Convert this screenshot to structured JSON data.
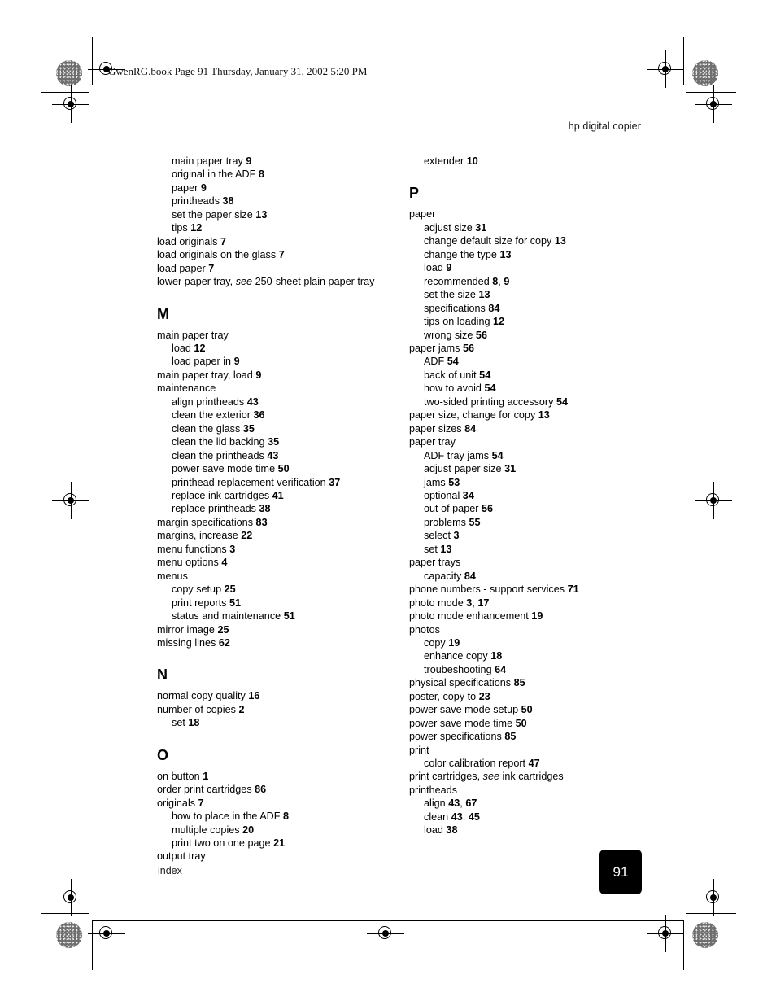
{
  "print_header": {
    "text": "GwenRG.book  Page 91  Thursday, January 31, 2002  5:20 PM"
  },
  "running_header": {
    "text": "hp digital  copier"
  },
  "footer": {
    "section_label": "index",
    "page_number": "91"
  },
  "colors": {
    "text": "#000000",
    "page_badge_bg": "#000000",
    "page_badge_text": "#ffffff",
    "paper": "#ffffff"
  },
  "index": {
    "left_column": [
      {
        "type": "entry",
        "level": 2,
        "text": "main paper tray ",
        "pages": "9"
      },
      {
        "type": "entry",
        "level": 2,
        "text": "original in the ADF ",
        "pages": "8"
      },
      {
        "type": "entry",
        "level": 2,
        "text": "paper ",
        "pages": "9"
      },
      {
        "type": "entry",
        "level": 2,
        "text": "printheads ",
        "pages": "38"
      },
      {
        "type": "entry",
        "level": 2,
        "text": "set the paper size ",
        "pages": "13"
      },
      {
        "type": "entry",
        "level": 2,
        "text": "tips ",
        "pages": "12"
      },
      {
        "type": "entry",
        "level": 1,
        "text": "load originals ",
        "pages": "7"
      },
      {
        "type": "entry",
        "level": 1,
        "text": "load originals on the glass ",
        "pages": "7"
      },
      {
        "type": "entry",
        "level": 1,
        "text": "load paper ",
        "pages": "7"
      },
      {
        "type": "entry",
        "level": 1,
        "text": "lower paper tray, ",
        "italic": "see",
        "after": " 250-sheet plain paper tray",
        "pages": ""
      },
      {
        "type": "letter",
        "text": "M"
      },
      {
        "type": "entry",
        "level": 1,
        "text": "main paper tray",
        "pages": ""
      },
      {
        "type": "entry",
        "level": 2,
        "text": "load ",
        "pages": "12"
      },
      {
        "type": "entry",
        "level": 2,
        "text": "load paper in ",
        "pages": "9"
      },
      {
        "type": "entry",
        "level": 1,
        "text": "main paper tray, load ",
        "pages": "9"
      },
      {
        "type": "entry",
        "level": 1,
        "text": "maintenance",
        "pages": ""
      },
      {
        "type": "entry",
        "level": 2,
        "text": "align printheads ",
        "pages": "43"
      },
      {
        "type": "entry",
        "level": 2,
        "text": "clean the exterior ",
        "pages": "36"
      },
      {
        "type": "entry",
        "level": 2,
        "text": "clean the glass ",
        "pages": "35"
      },
      {
        "type": "entry",
        "level": 2,
        "text": "clean the lid backing ",
        "pages": "35"
      },
      {
        "type": "entry",
        "level": 2,
        "text": "clean the printheads ",
        "pages": "43"
      },
      {
        "type": "entry",
        "level": 2,
        "text": "power save mode time ",
        "pages": "50"
      },
      {
        "type": "entry",
        "level": 2,
        "text": "printhead replacement verification ",
        "pages": "37"
      },
      {
        "type": "entry",
        "level": 2,
        "text": "replace ink cartridges ",
        "pages": "41"
      },
      {
        "type": "entry",
        "level": 2,
        "text": "replace printheads ",
        "pages": "38"
      },
      {
        "type": "entry",
        "level": 1,
        "text": "margin specifications ",
        "pages": "83"
      },
      {
        "type": "entry",
        "level": 1,
        "text": "margins, increase ",
        "pages": "22"
      },
      {
        "type": "entry",
        "level": 1,
        "text": "menu functions ",
        "pages": "3"
      },
      {
        "type": "entry",
        "level": 1,
        "text": "menu options ",
        "pages": "4"
      },
      {
        "type": "entry",
        "level": 1,
        "text": "menus",
        "pages": ""
      },
      {
        "type": "entry",
        "level": 2,
        "text": "copy setup ",
        "pages": "25"
      },
      {
        "type": "entry",
        "level": 2,
        "text": "print reports ",
        "pages": "51"
      },
      {
        "type": "entry",
        "level": 2,
        "text": "status and maintenance ",
        "pages": "51"
      },
      {
        "type": "entry",
        "level": 1,
        "text": "mirror image ",
        "pages": "25"
      },
      {
        "type": "entry",
        "level": 1,
        "text": "missing lines ",
        "pages": "62"
      },
      {
        "type": "letter",
        "text": "N"
      },
      {
        "type": "entry",
        "level": 1,
        "text": "normal copy quality ",
        "pages": "16"
      },
      {
        "type": "entry",
        "level": 1,
        "text": "number of copies ",
        "pages": "2"
      },
      {
        "type": "entry",
        "level": 2,
        "text": "set ",
        "pages": "18"
      },
      {
        "type": "letter",
        "text": "O"
      },
      {
        "type": "entry",
        "level": 1,
        "text": "on button ",
        "pages": "1"
      },
      {
        "type": "entry",
        "level": 1,
        "text": "order print cartridges ",
        "pages": "86"
      },
      {
        "type": "entry",
        "level": 1,
        "text": "originals ",
        "pages": "7"
      },
      {
        "type": "entry",
        "level": 2,
        "text": "how to place in the ADF ",
        "pages": "8"
      },
      {
        "type": "entry",
        "level": 2,
        "text": "multiple copies ",
        "pages": "20"
      },
      {
        "type": "entry",
        "level": 2,
        "text": "print two on one page ",
        "pages": "21"
      },
      {
        "type": "entry",
        "level": 1,
        "text": "output tray",
        "pages": ""
      }
    ],
    "right_column": [
      {
        "type": "entry",
        "level": 2,
        "text": "extender ",
        "pages": "10"
      },
      {
        "type": "letter",
        "text": "P"
      },
      {
        "type": "entry",
        "level": 1,
        "text": "paper",
        "pages": ""
      },
      {
        "type": "entry",
        "level": 2,
        "text": "adjust size ",
        "pages": "31"
      },
      {
        "type": "entry",
        "level": 2,
        "text": "change default size for copy ",
        "pages": "13"
      },
      {
        "type": "entry",
        "level": 2,
        "text": "change the type ",
        "pages": "13"
      },
      {
        "type": "entry",
        "level": 2,
        "text": "load ",
        "pages": "9"
      },
      {
        "type": "entry",
        "level": 2,
        "text": "recommended ",
        "pages": "8",
        "pages2": "9"
      },
      {
        "type": "entry",
        "level": 2,
        "text": "set the size ",
        "pages": "13"
      },
      {
        "type": "entry",
        "level": 2,
        "text": "specifications ",
        "pages": "84"
      },
      {
        "type": "entry",
        "level": 2,
        "text": "tips on loading ",
        "pages": "12"
      },
      {
        "type": "entry",
        "level": 2,
        "text": "wrong size ",
        "pages": "56"
      },
      {
        "type": "entry",
        "level": 1,
        "text": "paper jams ",
        "pages": "56"
      },
      {
        "type": "entry",
        "level": 2,
        "text": "ADF ",
        "pages": "54"
      },
      {
        "type": "entry",
        "level": 2,
        "text": "back of unit ",
        "pages": "54"
      },
      {
        "type": "entry",
        "level": 2,
        "text": "how to avoid ",
        "pages": "54"
      },
      {
        "type": "entry",
        "level": 2,
        "text": "two-sided printing accessory ",
        "pages": "54"
      },
      {
        "type": "entry",
        "level": 1,
        "text": "paper size, change for copy ",
        "pages": "13"
      },
      {
        "type": "entry",
        "level": 1,
        "text": "paper sizes ",
        "pages": "84"
      },
      {
        "type": "entry",
        "level": 1,
        "text": "paper tray",
        "pages": ""
      },
      {
        "type": "entry",
        "level": 2,
        "text": "ADF tray jams ",
        "pages": "54"
      },
      {
        "type": "entry",
        "level": 2,
        "text": "adjust paper size ",
        "pages": "31"
      },
      {
        "type": "entry",
        "level": 2,
        "text": "jams ",
        "pages": "53"
      },
      {
        "type": "entry",
        "level": 2,
        "text": "optional ",
        "pages": "34"
      },
      {
        "type": "entry",
        "level": 2,
        "text": "out of paper ",
        "pages": "56"
      },
      {
        "type": "entry",
        "level": 2,
        "text": "problems ",
        "pages": "55"
      },
      {
        "type": "entry",
        "level": 2,
        "text": "select ",
        "pages": "3"
      },
      {
        "type": "entry",
        "level": 2,
        "text": "set ",
        "pages": "13"
      },
      {
        "type": "entry",
        "level": 1,
        "text": "paper trays",
        "pages": ""
      },
      {
        "type": "entry",
        "level": 2,
        "text": "capacity ",
        "pages": "84"
      },
      {
        "type": "entry",
        "level": 1,
        "text": "phone numbers - support services ",
        "pages": "71"
      },
      {
        "type": "entry",
        "level": 1,
        "text": "photo mode ",
        "pages": "3",
        "pages2": "17"
      },
      {
        "type": "entry",
        "level": 1,
        "text": "photo mode enhancement ",
        "pages": "19"
      },
      {
        "type": "entry",
        "level": 1,
        "text": "photos",
        "pages": ""
      },
      {
        "type": "entry",
        "level": 2,
        "text": "copy ",
        "pages": "19"
      },
      {
        "type": "entry",
        "level": 2,
        "text": "enhance copy ",
        "pages": "18"
      },
      {
        "type": "entry",
        "level": 2,
        "text": "troubeshooting ",
        "pages": "64"
      },
      {
        "type": "entry",
        "level": 1,
        "text": "physical specifications ",
        "pages": "85"
      },
      {
        "type": "entry",
        "level": 1,
        "text": "poster, copy to ",
        "pages": "23"
      },
      {
        "type": "entry",
        "level": 1,
        "text": "power save mode setup ",
        "pages": "50"
      },
      {
        "type": "entry",
        "level": 1,
        "text": "power save mode time ",
        "pages": "50"
      },
      {
        "type": "entry",
        "level": 1,
        "text": "power specifications ",
        "pages": "85"
      },
      {
        "type": "entry",
        "level": 1,
        "text": "print",
        "pages": ""
      },
      {
        "type": "entry",
        "level": 2,
        "text": "color calibration report ",
        "pages": "47"
      },
      {
        "type": "entry",
        "level": 1,
        "text": "print cartridges, ",
        "italic": "see",
        "after": " ink cartridges",
        "pages": ""
      },
      {
        "type": "entry",
        "level": 1,
        "text": "printheads",
        "pages": ""
      },
      {
        "type": "entry",
        "level": 2,
        "text": "align ",
        "pages": "43",
        "pages2": "67"
      },
      {
        "type": "entry",
        "level": 2,
        "text": "clean ",
        "pages": "43",
        "pages2": "45"
      },
      {
        "type": "entry",
        "level": 2,
        "text": "load ",
        "pages": "38"
      }
    ]
  }
}
